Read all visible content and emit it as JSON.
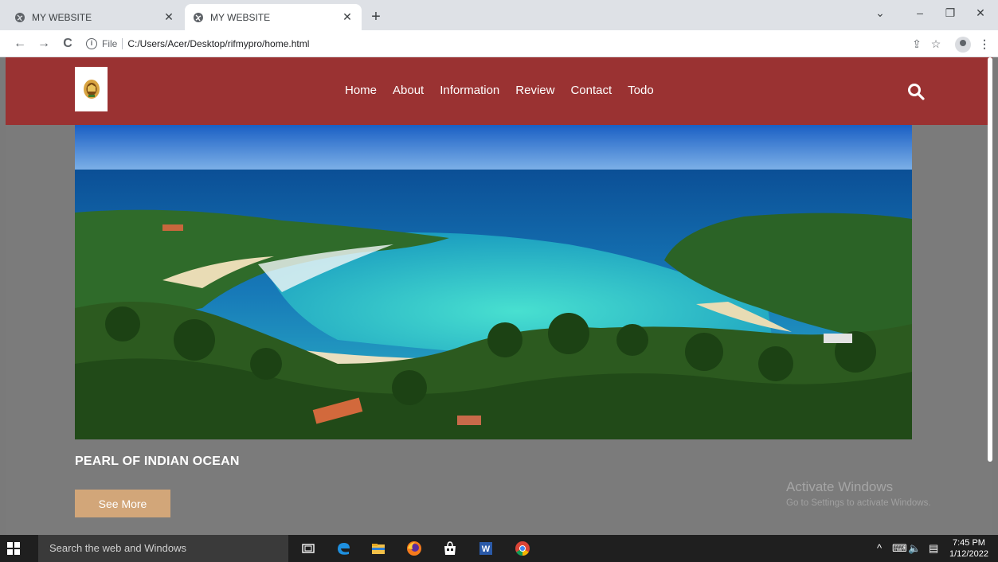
{
  "browser": {
    "tabs": [
      {
        "title": "MY WEBSITE",
        "active": false
      },
      {
        "title": "MY WEBSITE",
        "active": true
      }
    ],
    "address": {
      "scheme_label": "File",
      "url": "C:/Users/Acer/Desktop/rifmypro/home.html"
    }
  },
  "site": {
    "nav": [
      {
        "label": "Home"
      },
      {
        "label": "About"
      },
      {
        "label": "Information"
      },
      {
        "label": "Review"
      },
      {
        "label": "Contact"
      },
      {
        "label": "Todo"
      }
    ],
    "hero_caption": "PEARL OF INDIAN OCEAN",
    "see_more_label": "See More",
    "colors": {
      "navbar": "#9a3232",
      "button": "#d2a679",
      "page_bg": "#7b7b7b"
    }
  },
  "watermark": {
    "title": "Activate Windows",
    "subtitle": "Go to Settings to activate Windows."
  },
  "taskbar": {
    "search_placeholder": "Search the web and Windows",
    "time": "7:45 PM",
    "date": "1/12/2022"
  }
}
